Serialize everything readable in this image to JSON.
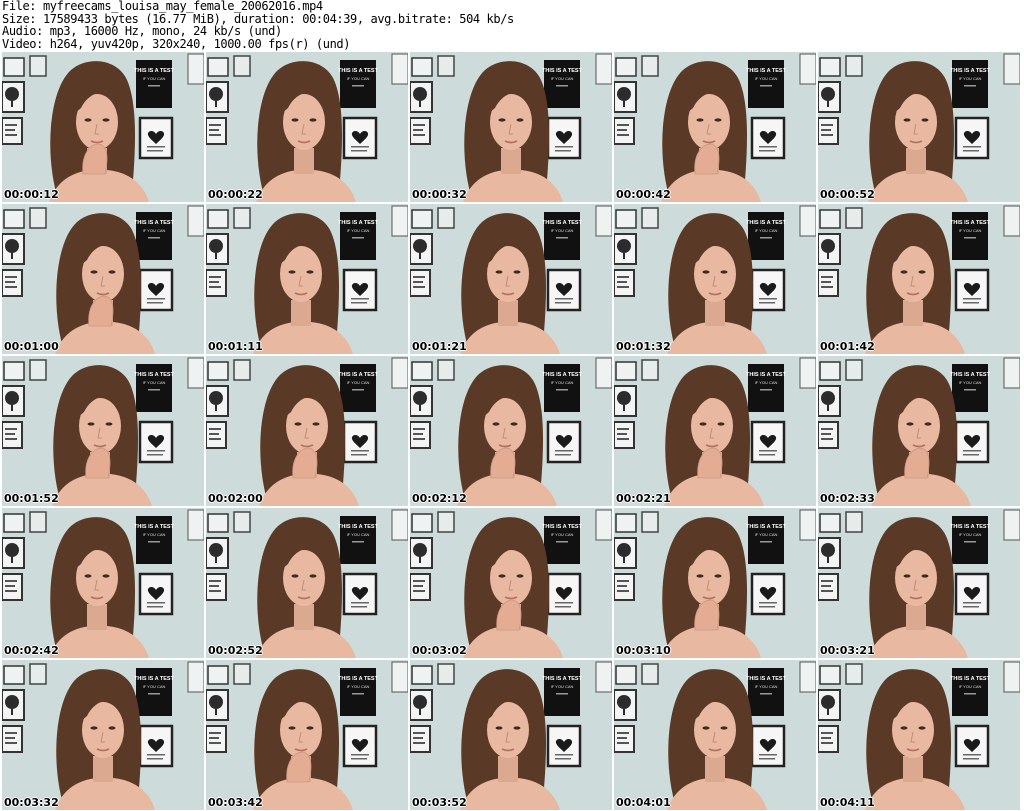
{
  "header": {
    "file_line": "File: myfreecams_louisa_may_female_20062016.mp4",
    "size_line": "Size: 17589433 bytes (16.77 MiB), duration: 00:04:39, avg.bitrate: 504 kb/s",
    "audio_line": "Audio: mp3, 16000 Hz, mono, 24 kb/s (und)",
    "video_line": "Video: h264, yuv420p, 320x240, 1000.00 fps(r) (und)"
  },
  "poster_text": {
    "title": "THIS IS A TEST",
    "line2": "IF YOU CAN"
  },
  "colors": {
    "wall": "#c9dad7",
    "hair": "#5a3a26",
    "skin": "#e8b9a0",
    "poster": "#111111"
  },
  "thumbnails": [
    {
      "timestamp": "00:00:12",
      "hand": true
    },
    {
      "timestamp": "00:00:22",
      "hand": false
    },
    {
      "timestamp": "00:00:32",
      "hand": false
    },
    {
      "timestamp": "00:00:42",
      "hand": true
    },
    {
      "timestamp": "00:00:52",
      "hand": false
    },
    {
      "timestamp": "00:01:00",
      "hand": true
    },
    {
      "timestamp": "00:01:11",
      "hand": false
    },
    {
      "timestamp": "00:01:21",
      "hand": false
    },
    {
      "timestamp": "00:01:32",
      "hand": false
    },
    {
      "timestamp": "00:01:42",
      "hand": false
    },
    {
      "timestamp": "00:01:52",
      "hand": true
    },
    {
      "timestamp": "00:02:00",
      "hand": true
    },
    {
      "timestamp": "00:02:12",
      "hand": true
    },
    {
      "timestamp": "00:02:21",
      "hand": true
    },
    {
      "timestamp": "00:02:33",
      "hand": true
    },
    {
      "timestamp": "00:02:42",
      "hand": false
    },
    {
      "timestamp": "00:02:52",
      "hand": false
    },
    {
      "timestamp": "00:03:02",
      "hand": true
    },
    {
      "timestamp": "00:03:10",
      "hand": true
    },
    {
      "timestamp": "00:03:21",
      "hand": false
    },
    {
      "timestamp": "00:03:32",
      "hand": false
    },
    {
      "timestamp": "00:03:42",
      "hand": true
    },
    {
      "timestamp": "00:03:52",
      "hand": false
    },
    {
      "timestamp": "00:04:01",
      "hand": false
    },
    {
      "timestamp": "00:04:11",
      "hand": false
    }
  ]
}
